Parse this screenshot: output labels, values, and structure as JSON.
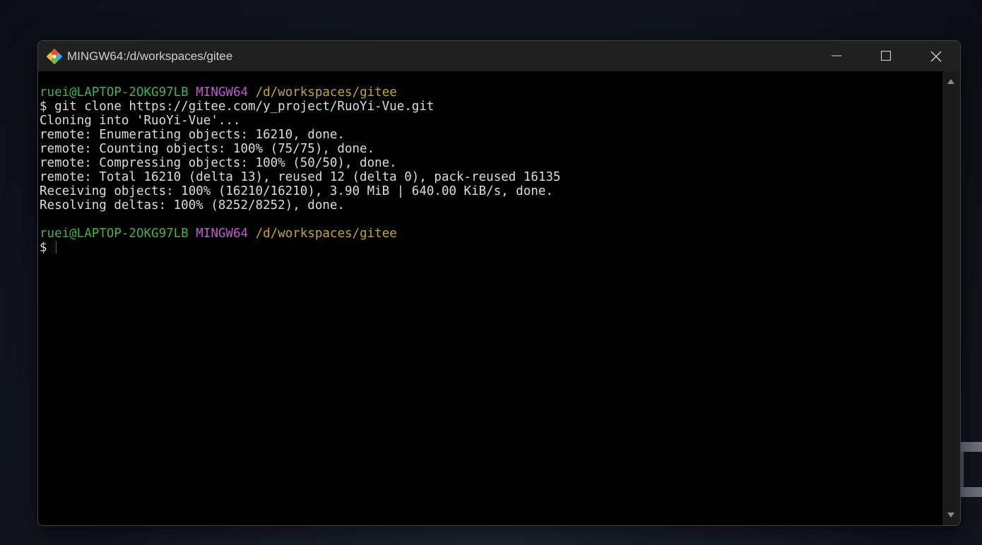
{
  "window": {
    "title": "MINGW64:/d/workspaces/gitee",
    "icon": "git-icon",
    "controls": [
      "minimize-icon",
      "maximize-icon",
      "close-icon"
    ]
  },
  "colors": {
    "user_host": "#3fb34f",
    "env": "#c05ad1",
    "path": "#c6a432",
    "output": "#dcdcdc"
  },
  "terminal": {
    "prompt1": {
      "user_host": "ruei@LAPTOP-2OKG97LB",
      "env": "MINGW64",
      "path": "/d/workspaces/gitee"
    },
    "command": "$ git clone https://gitee.com/y_project/RuoYi-Vue.git",
    "output": [
      "Cloning into 'RuoYi-Vue'...",
      "remote: Enumerating objects: 16210, done.",
      "remote: Counting objects: 100% (75/75), done.",
      "remote: Compressing objects: 100% (50/50), done.",
      "remote: Total 16210 (delta 13), reused 12 (delta 0), pack-reused 16135",
      "Receiving objects: 100% (16210/16210), 3.90 MiB | 640.00 KiB/s, done.",
      "Resolving deltas: 100% (8252/8252), done."
    ],
    "prompt2": {
      "user_host": "ruei@LAPTOP-2OKG97LB",
      "env": "MINGW64",
      "path": "/d/workspaces/gitee"
    },
    "input_prefix": "$ "
  }
}
